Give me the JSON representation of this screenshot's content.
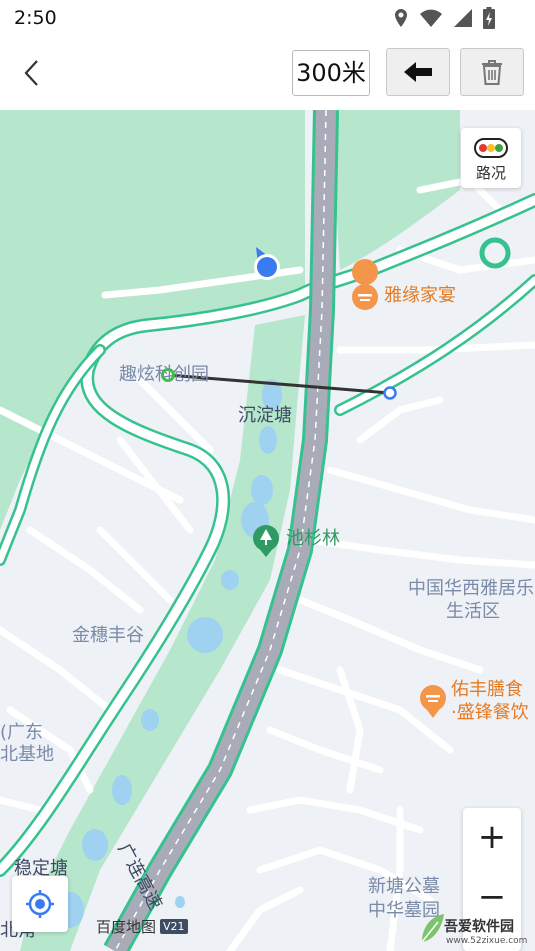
{
  "status_bar": {
    "time": "2:50",
    "icons": [
      "location-icon",
      "wifi-icon",
      "signal-icon",
      "battery-icon"
    ]
  },
  "toolbar": {
    "distance": "300米",
    "back_icon": "chevron-left-icon",
    "undo_icon": "arrow-left-icon",
    "delete_icon": "trash-icon"
  },
  "map": {
    "traffic_label": "路况",
    "zoom_in": "+",
    "zoom_out": "−",
    "logo": "百度地图",
    "logo_version": "V21",
    "places": {
      "yayuan": "雅缘家宴",
      "quxuan": "趣炫科创园",
      "chendiantang": "沉淀塘",
      "chishanlin": "池杉林",
      "huaxi": "中国华西雅居乐",
      "shenghuoqu": "生活区",
      "jinsuifeng": "金穗丰谷",
      "youfeng": "佑丰膳食",
      "shengfeng": "·盛锋餐饮",
      "guangdong": "(广东",
      "beijidi": "北基地",
      "guanglian": "广连高速",
      "wending": "稳定塘",
      "xintang": "新塘公墓",
      "zhonghua": "中华墓园",
      "beijiao": "北角"
    },
    "colors": {
      "green_area": "#b6e6cc",
      "road_outline": "#36c28e",
      "highway": "#a9acb8",
      "water": "#9fd1f0",
      "measure_line": "#333333",
      "poi_orange": "#f3964a",
      "location_blue": "#3a7bf0"
    }
  },
  "watermark": {
    "text": "吾爱软件园",
    "url": "www.52zixue.com"
  }
}
